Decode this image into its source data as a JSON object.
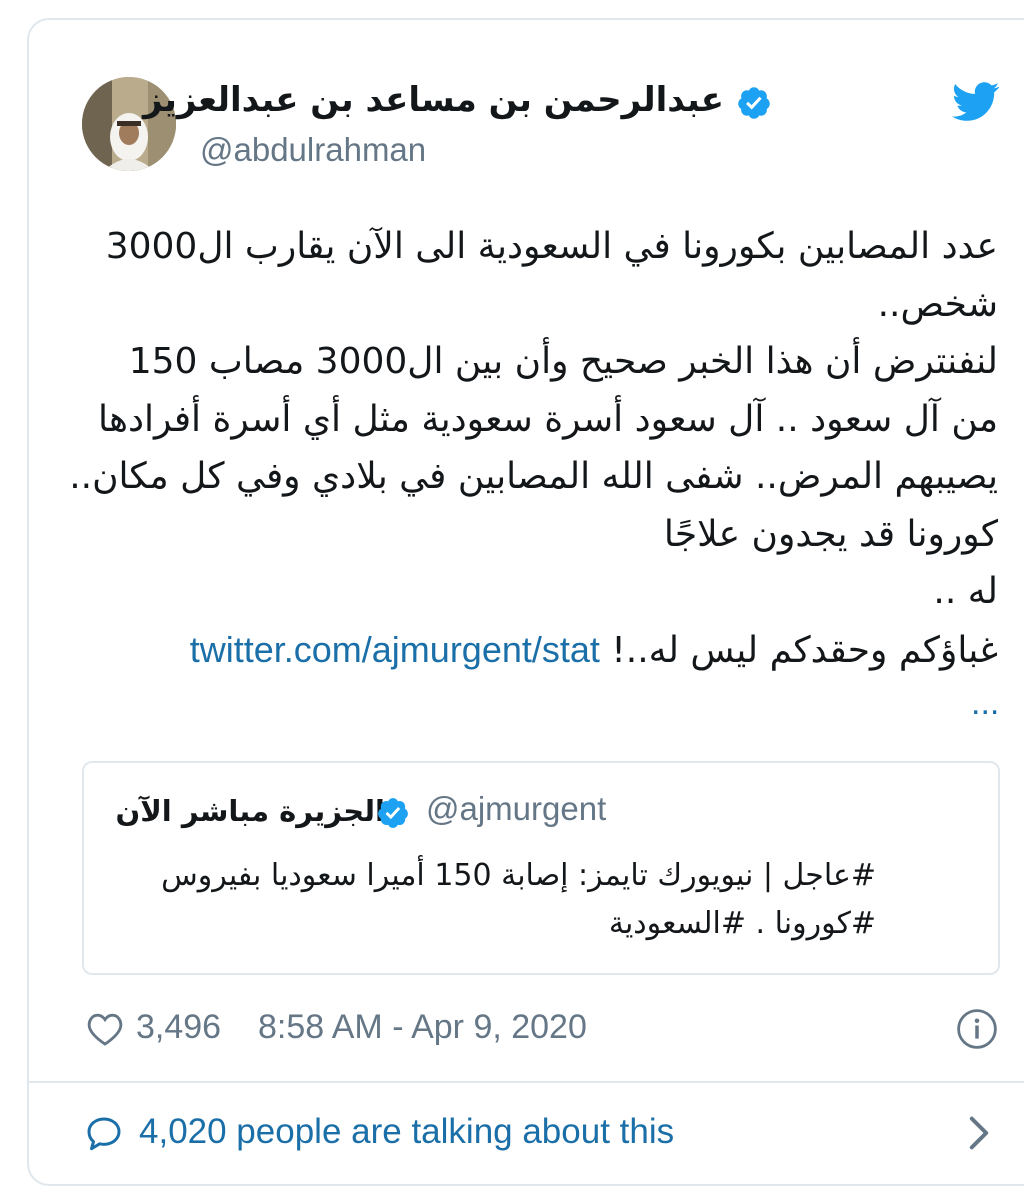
{
  "author": {
    "name": "عبدالرحمن بن مساعد بن عبدالعزيز",
    "handle": "@abdulrahman",
    "verified_icon": "verified-badge-icon",
    "avatar_icon": "profile-photo"
  },
  "brand": {
    "icon": "twitter-bird-icon",
    "color": "#1da1f2"
  },
  "tweet": {
    "lines": [
      "عدد  المصابين بكورونا في السعودية الى الآن يقارب ال3000",
      "شخص..",
      "لنفنترض أن هذا الخبر صحيح وأن بين ال3000 مصاب 150",
      "من آل سعود .. آل سعود أسرة سعودية مثل أي أسرة  أفرادها",
      "يصيبهم المرض.. شفى الله المصابين في بلادي وفي كل مكان..",
      "كورونا قد يجدون علاجًا",
      "له ..",
      "غباؤكم وحقدكم ليس له..!"
    ],
    "link": "twitter.com/ajmurgent/stat",
    "ellipsis": "..."
  },
  "quoted": {
    "name": "الجزيرة مباشر الآن",
    "handle": "@ajmurgent",
    "lines": [
      "#عاجل | نيويورك تايمز: إصابة 150 أميرا سعوديا بفيروس",
      "#كورونا . #السعودية"
    ]
  },
  "footer": {
    "likes": "3,496",
    "timestamp": "8:58 AM - Apr 9, 2020",
    "talking": "4,020 people are talking about this"
  },
  "colors": {
    "link": "#1b6fa8",
    "muted": "#657786",
    "border": "#e1e8ed",
    "verified": "#1da1f2"
  }
}
